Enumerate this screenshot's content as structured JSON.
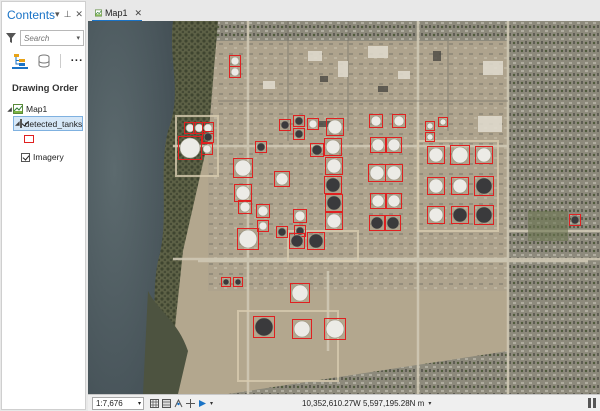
{
  "contents": {
    "title": "Contents",
    "search_placeholder": "Search",
    "section_title": "Drawing Order"
  },
  "tree": {
    "map_name": "Map1",
    "layers": [
      {
        "name": "detected_tanks",
        "checked": true,
        "selected": true,
        "symbol_color": "#e02020"
      },
      {
        "name": "Imagery",
        "checked": true,
        "selected": false
      }
    ]
  },
  "map_tab": {
    "label": "Map1"
  },
  "statusbar": {
    "scale": "1:7,676",
    "coordinates": "10,352,610.27W 5,597,195.28N m"
  },
  "colors": {
    "accent": "#1a73c6",
    "tank_outline": "#e02020"
  }
}
